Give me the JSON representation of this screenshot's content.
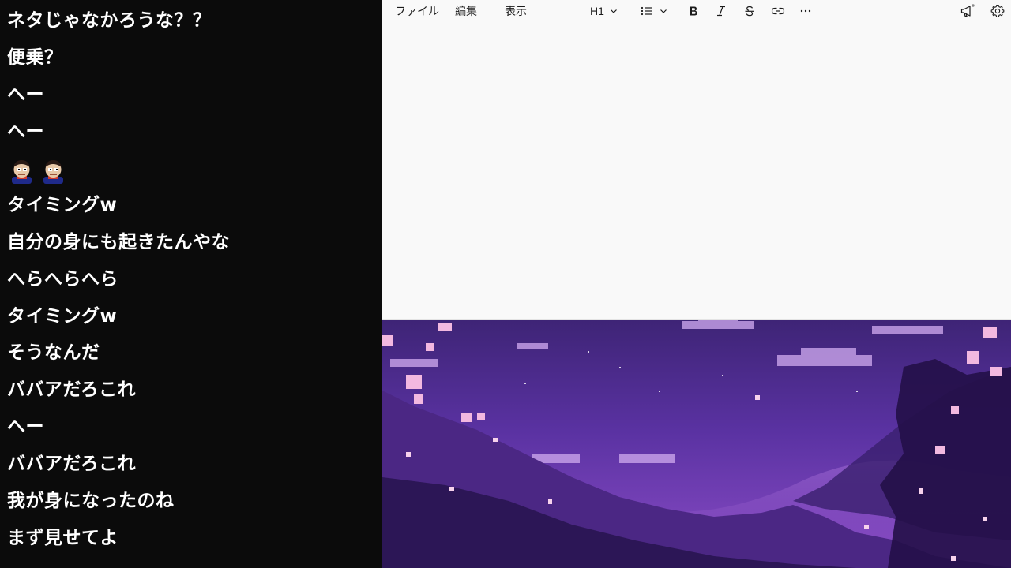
{
  "chat": {
    "messages": [
      "ネタじゃなかろうな？？",
      "便乗？",
      "へー",
      "へー",
      "タイミングw",
      "自分の身にも起きたんやな",
      "へらへらへら",
      "タイミングw",
      "そうなんだ",
      "ババアだろこれ",
      "へー",
      "ババアだろこれ",
      "我が身になったのね",
      "まず見せてよ"
    ],
    "emote_row": [
      "emote-face-icon",
      "emote-face-icon"
    ]
  },
  "notepad": {
    "menu": {
      "file": "ファイル",
      "edit": "編集",
      "view": "表示"
    },
    "toolbar": {
      "heading": "H1",
      "icons": [
        "chevron-down-icon",
        "list-icon",
        "bold-icon",
        "italic-icon",
        "strikethrough-icon",
        "link-icon",
        "more-icon",
        "announcement-icon",
        "settings-icon"
      ]
    },
    "editor_text": ""
  },
  "colors": {
    "chat_bg": "#0b0b0b",
    "chat_text": "#ffffff",
    "notepad_bg": "#f9f9f9",
    "wallpaper_purple": "#5b32a0",
    "blossom_pink": "#f2b8e0"
  }
}
